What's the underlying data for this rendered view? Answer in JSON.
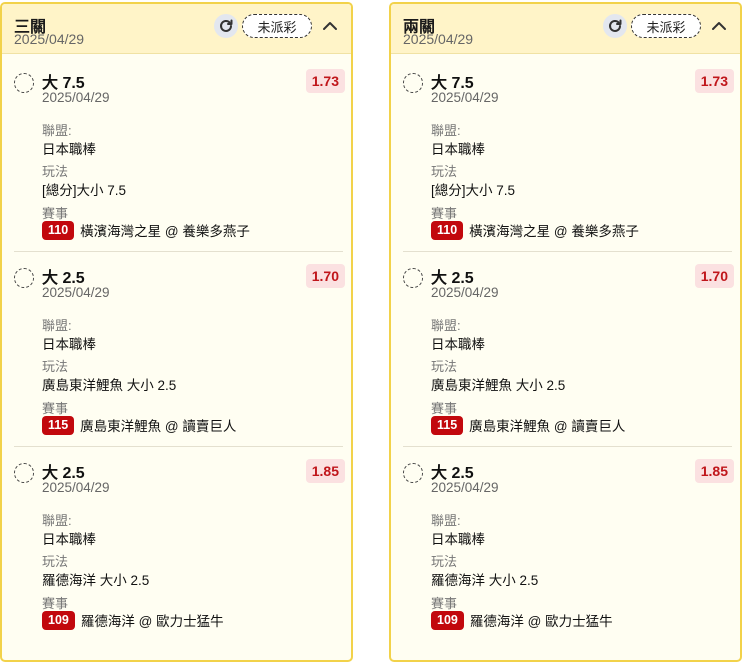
{
  "panels": [
    {
      "title": "三關",
      "date": "2025/04/29",
      "status": "未派彩",
      "bets": [
        {
          "title": "大 7.5",
          "date": "2025/04/29",
          "odds": "1.73",
          "league_label": "聯盟:",
          "league": "日本職棒",
          "play_label": "玩法",
          "play": "[總分]大小 7.5",
          "match_label": "賽事",
          "match_id": "110",
          "match": "橫濱海灣之星 @ 養樂多燕子"
        },
        {
          "title": "大 2.5",
          "date": "2025/04/29",
          "odds": "1.70",
          "league_label": "聯盟:",
          "league": "日本職棒",
          "play_label": "玩法",
          "play": "廣島東洋鯉魚 大小 2.5",
          "match_label": "賽事",
          "match_id": "115",
          "match": "廣島東洋鯉魚 @ 讀賣巨人"
        },
        {
          "title": "大 2.5",
          "date": "2025/04/29",
          "odds": "1.85",
          "league_label": "聯盟:",
          "league": "日本職棒",
          "play_label": "玩法",
          "play": "羅德海洋 大小 2.5",
          "match_label": "賽事",
          "match_id": "109",
          "match": "羅德海洋 @ 歐力士猛牛"
        }
      ]
    },
    {
      "title": "兩關",
      "date": "2025/04/29",
      "status": "未派彩",
      "bets": [
        {
          "title": "大 7.5",
          "date": "2025/04/29",
          "odds": "1.73",
          "league_label": "聯盟:",
          "league": "日本職棒",
          "play_label": "玩法",
          "play": "[總分]大小 7.5",
          "match_label": "賽事",
          "match_id": "110",
          "match": "橫濱海灣之星 @ 養樂多燕子"
        },
        {
          "title": "大 2.5",
          "date": "2025/04/29",
          "odds": "1.70",
          "league_label": "聯盟:",
          "league": "日本職棒",
          "play_label": "玩法",
          "play": "廣島東洋鯉魚 大小 2.5",
          "match_label": "賽事",
          "match_id": "115",
          "match": "廣島東洋鯉魚 @ 讀賣巨人"
        },
        {
          "title": "大 2.5",
          "date": "2025/04/29",
          "odds": "1.85",
          "league_label": "聯盟:",
          "league": "日本職棒",
          "play_label": "玩法",
          "play": "羅德海洋 大小 2.5",
          "match_label": "賽事",
          "match_id": "109",
          "match": "羅德海洋 @ 歐力士猛牛"
        }
      ]
    }
  ],
  "icons": {
    "refresh": "refresh-icon",
    "collapse": "chevron-up-icon"
  },
  "colors": {
    "panel_border": "#f2d24a",
    "header_bg": "#fff4c8",
    "odds_text": "#c0161b",
    "odds_bg": "#fbe1e1",
    "match_id_bg": "#c2080d"
  }
}
